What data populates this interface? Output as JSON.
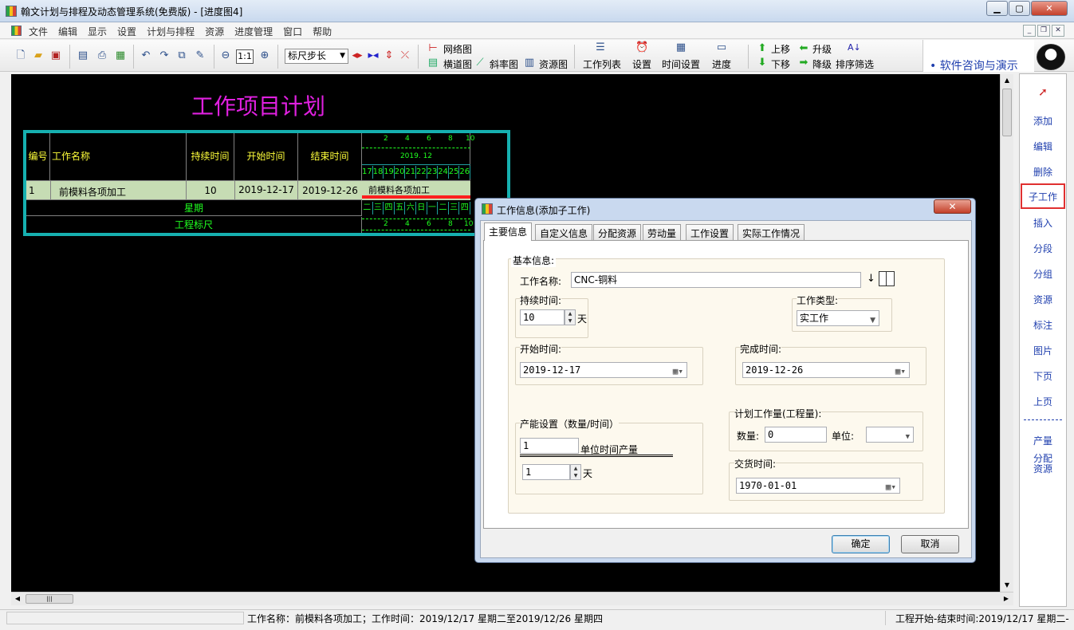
{
  "window": {
    "title": "翰文计划与排程及动态管理系统(免费版) - [进度图4]"
  },
  "menu": [
    "文件",
    "编辑",
    "显示",
    "设置",
    "计划与排程",
    "资源",
    "进度管理",
    "窗口",
    "帮助"
  ],
  "toolbar": {
    "zoom_label": "1:1",
    "ruler_step": "标尺步长",
    "network": "网络图",
    "bar": "横道图",
    "slope": "斜率图",
    "resource": "资源图",
    "work_list": "工作列表",
    "settings": "设置",
    "time_settings": "时间设置",
    "progress": "进度",
    "move_up": "上移",
    "move_down": "下移",
    "promote": "升级",
    "demote": "降级",
    "sort_filter": "排序筛选",
    "consult_link": "软件咨询与演示"
  },
  "plan": {
    "title": "工作项目计划",
    "headers": {
      "no": "编号",
      "name": "工作名称",
      "duration": "持续时间",
      "start": "开始时间",
      "end": "结束时间"
    },
    "rows": [
      {
        "no": "1",
        "name": "前模料各项加工",
        "duration": "10",
        "start": "2019-12-17",
        "end": "2019-12-26",
        "bar_label": "前模料各项加工"
      }
    ],
    "week_label": "星期",
    "ruler_label": "工程标尺",
    "top_ticks": [
      "2",
      "4",
      "6",
      "8",
      "10"
    ],
    "month": "2019. 12",
    "days": [
      "17",
      "18",
      "19",
      "20",
      "21",
      "22",
      "23",
      "24",
      "25",
      "26"
    ],
    "weekdays": [
      "二",
      "三",
      "四",
      "五",
      "六",
      "日",
      "一",
      "二",
      "三",
      "四"
    ],
    "bottom_ticks": [
      "2",
      "4",
      "6",
      "8",
      "10"
    ]
  },
  "dialog": {
    "title": "工作信息(添加子工作)",
    "close": "✕",
    "tabs": [
      "主要信息",
      "自定义信息",
      "分配资源",
      "劳动量",
      "工作设置",
      "实际工作情况"
    ],
    "basic_info": "基本信息:",
    "work_name_label": "工作名称:",
    "work_name_value": "CNC-铜料",
    "duration_label": "持续时间:",
    "duration_value": "10",
    "day_unit": "天",
    "work_type_label": "工作类型:",
    "work_type_value": "实工作",
    "start_label": "开始时间:",
    "start_value": "2019-12-17",
    "finish_label": "完成时间:",
    "finish_value": "2019-12-26",
    "capacity_label": "产能设置（数量/时间）",
    "capacity_qty": "1",
    "unit_output": "单位时间产量",
    "capacity_time": "1",
    "planned_label": "计划工作量(工程量):",
    "qty_label": "数量:",
    "qty_value": "0",
    "unit_label": "单位:",
    "unit_value": "",
    "delivery_label": "交货时间:",
    "delivery_value": "1970-01-01",
    "ok": "确定",
    "cancel": "取消"
  },
  "right_panel": [
    "添加",
    "编辑",
    "删除",
    "子工作",
    "插入",
    "分段",
    "分组",
    "资源",
    "标注",
    "图片",
    "下页",
    "上页",
    "产量",
    "分配资源"
  ],
  "status": {
    "info": "工作名称：前模料各项加工；工作时间：2019/12/17 星期二至2019/12/26 星期四",
    "right": "工程开始-结束时间:2019/12/17 星期二-"
  }
}
